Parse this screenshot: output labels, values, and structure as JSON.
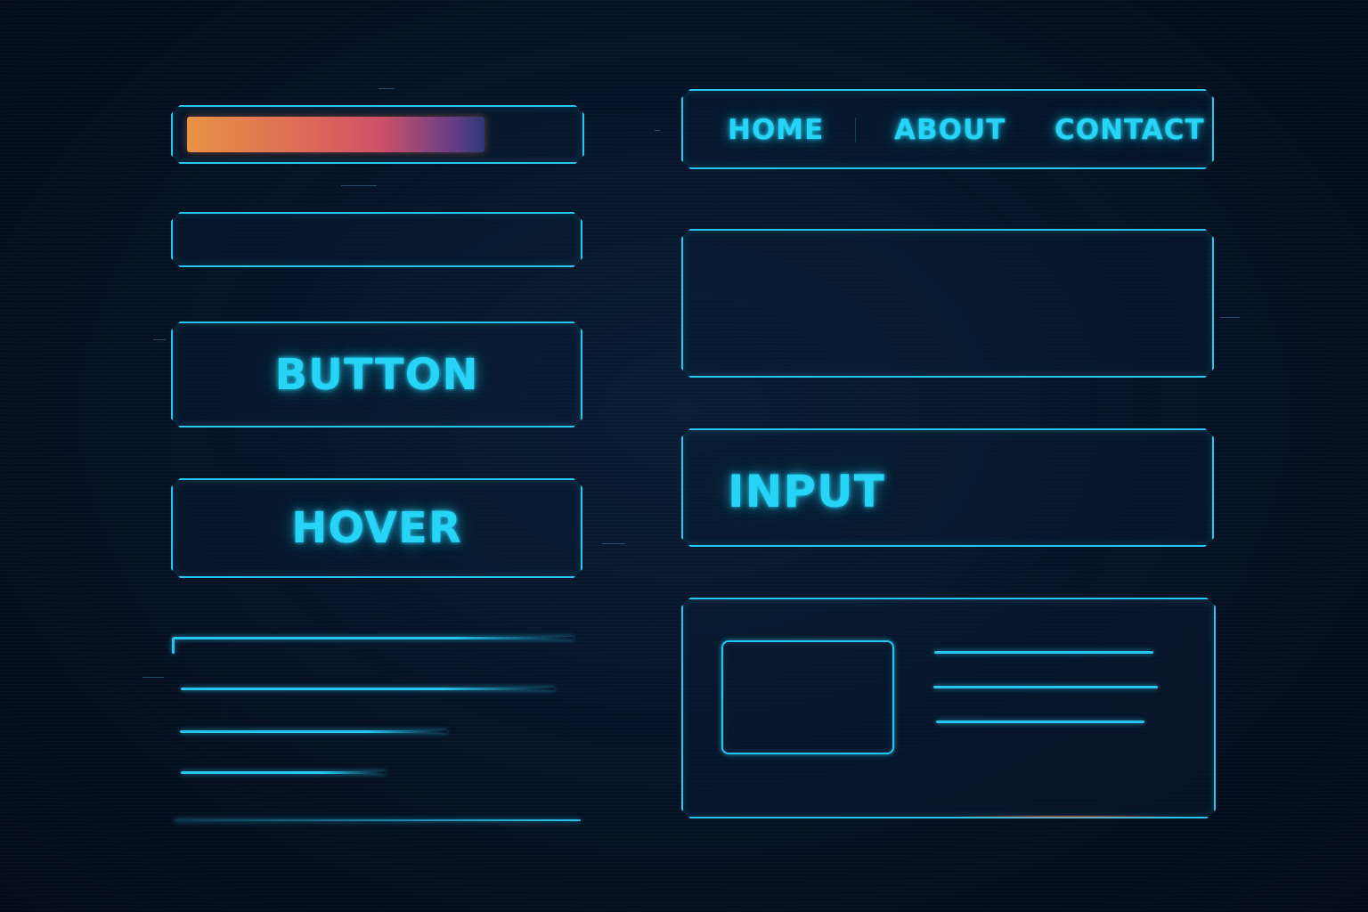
{
  "progress": {
    "value": 0.78,
    "gradient_colors": [
      "#f49a47",
      "#e96e5c",
      "#d9556b",
      "#6a3f8c",
      "#2f3b7a"
    ]
  },
  "buttons": {
    "primary_label": "BUTTON",
    "hover_label": "HOVER"
  },
  "nav": {
    "items": [
      {
        "label": "HOME"
      },
      {
        "label": "ABOUT"
      },
      {
        "label": "CONTACT"
      }
    ]
  },
  "input": {
    "value": "INPUT"
  },
  "theme": {
    "accent": "#27c6f0",
    "text_glow": "#25d4f7",
    "background": "#04101f"
  }
}
